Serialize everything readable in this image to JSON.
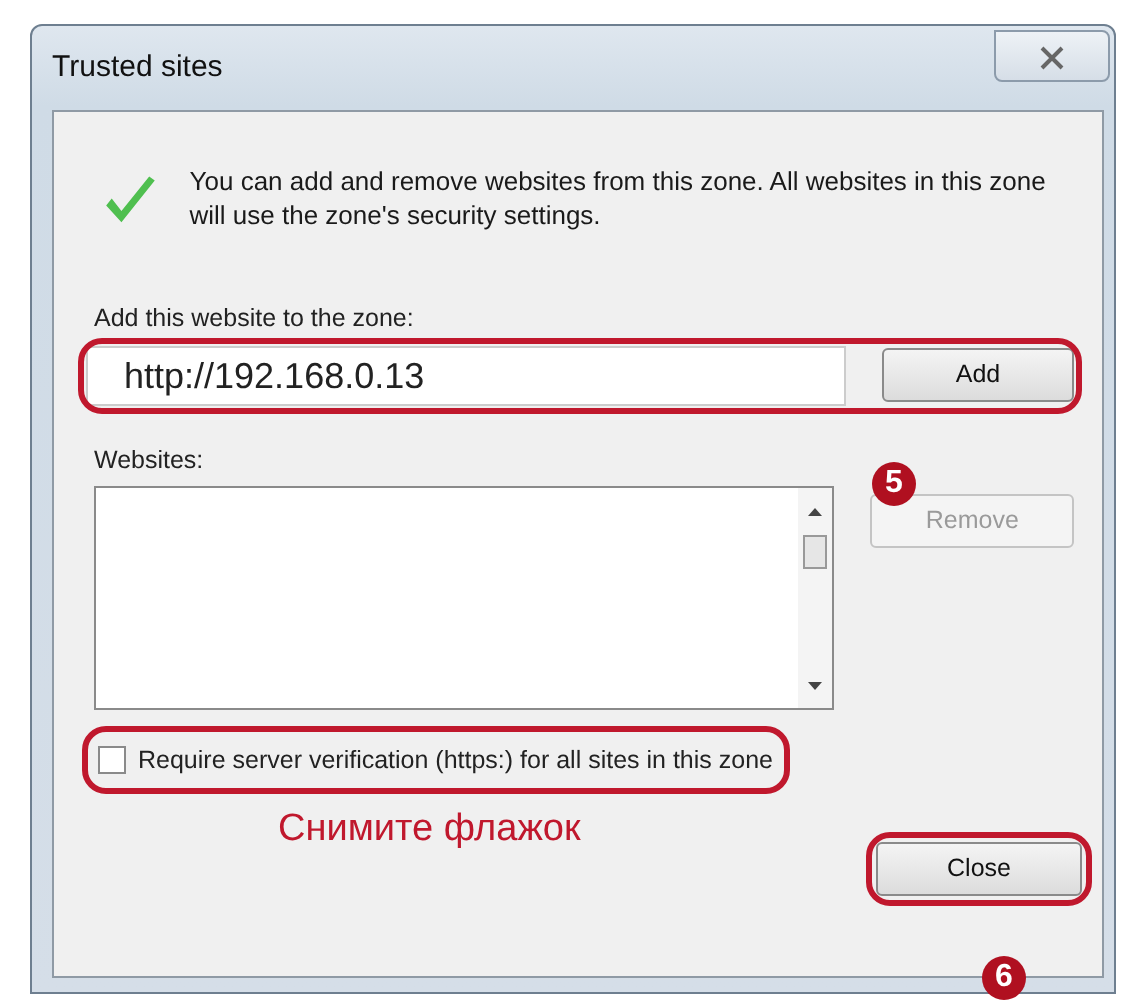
{
  "window": {
    "title": "Trusted sites"
  },
  "info_text": "You can add and remove websites from this zone. All websites in this zone will use the zone's security settings.",
  "add_label": "Add this website to the zone:",
  "url_row": {
    "value": "http://192.168.0.13",
    "button": "Add",
    "highlighted": true
  },
  "websites_label": "Websites:",
  "remove_button": {
    "label": "Remove",
    "disabled": true
  },
  "https_checkbox": {
    "label": "Require server verification (https:) for all sites in this zone",
    "checked": false,
    "highlighted": true
  },
  "close_button": {
    "label": "Close",
    "highlighted": true
  },
  "annotations": [
    {
      "kind": "step",
      "text": "5"
    },
    {
      "kind": "note",
      "text": "Снимите флажок"
    },
    {
      "kind": "step",
      "text": "6"
    }
  ]
}
